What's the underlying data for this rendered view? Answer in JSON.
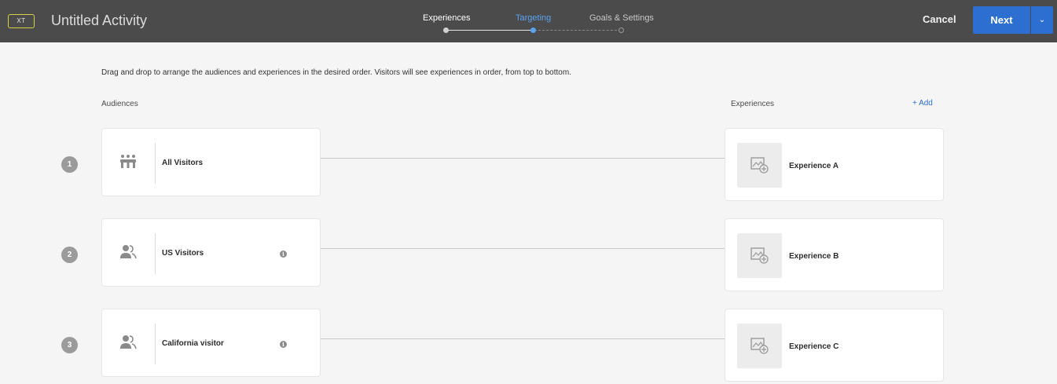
{
  "header": {
    "badge": "XT",
    "title": "Untitled Activity",
    "steps": [
      {
        "label": "Experiences",
        "state": "completed"
      },
      {
        "label": "Targeting",
        "state": "active"
      },
      {
        "label": "Goals & Settings",
        "state": "pending"
      }
    ],
    "cancel_label": "Cancel",
    "next_label": "Next",
    "dropdown_glyph": "⌄"
  },
  "content": {
    "instructions": "Drag and drop to arrange the audiences and experiences in the desired order. Visitors will see experiences in order, from top to bottom.",
    "audiences_label": "Audiences",
    "experiences_label": "Experiences",
    "add_label": "+  Add"
  },
  "rows": [
    {
      "number": "1",
      "audience": "All Visitors",
      "audience_icon": "group-icon",
      "has_info": false,
      "experience": "Experience A"
    },
    {
      "number": "2",
      "audience": "US Visitors",
      "audience_icon": "users-icon",
      "has_info": true,
      "experience": "Experience B"
    },
    {
      "number": "3",
      "audience": "California visitor",
      "audience_icon": "users-icon",
      "has_info": true,
      "experience": "Experience C"
    }
  ],
  "colors": {
    "header_bg": "#4b4b4b",
    "accent_blue": "#2d6fd1",
    "active_step": "#5aa3f0",
    "badge_border": "#d6d247",
    "page_bg": "#f5f5f5"
  }
}
